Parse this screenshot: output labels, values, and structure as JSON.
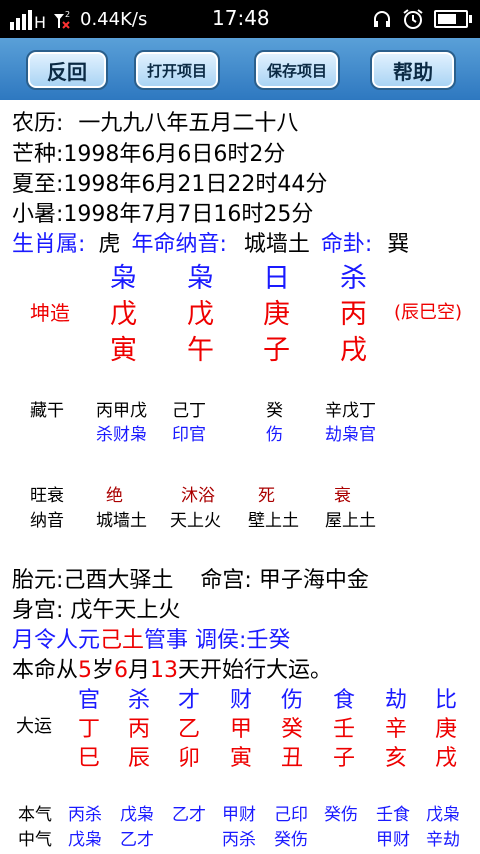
{
  "status": {
    "speed": "0.44K/s",
    "time": "17:48"
  },
  "toolbar": {
    "back": "反回",
    "open": "打开项目",
    "save": "保存项目",
    "help": "帮助"
  },
  "info": {
    "lunar_label": "农历:",
    "lunar": "一九九八年五月二十八",
    "line2": "芒种:1998年6月6日6时2分",
    "line3": "夏至:1998年6月21日22时44分",
    "line4": "小暑:1998年7月7日16时25分"
  },
  "zodiac": {
    "shengxiao_label": "生肖属:",
    "shengxiao": "虎",
    "nayin_label": "年命纳音:",
    "nayin": "城墙土",
    "minggua_label": "命卦:",
    "minggua": "巽"
  },
  "chart": {
    "gender": "坤造",
    "kongwang": "(辰巳空)",
    "gods": [
      "枭",
      "枭",
      "日",
      "杀"
    ],
    "stems": [
      "戊",
      "戊",
      "庚",
      "丙"
    ],
    "branches": [
      "寅",
      "午",
      "子",
      "戌"
    ]
  },
  "hidden": {
    "label": "藏干",
    "stems": [
      "丙甲戊",
      "己丁",
      "癸",
      "辛戊丁"
    ],
    "gods": [
      "杀财枭",
      "印官",
      "伤",
      "劫枭官"
    ]
  },
  "state": {
    "wang_label": "旺衰",
    "wang": [
      "绝",
      "沐浴",
      "死",
      "衰"
    ],
    "nayin_label": "纳音",
    "nayin": [
      "城墙土",
      "天上火",
      "壁上土",
      "屋上土"
    ]
  },
  "palace": {
    "taiyuan": "胎元:己酉大驿土",
    "minggong": "命宫: 甲子海中金",
    "shengong": "身宫: 戊午天上火"
  },
  "yueling": {
    "p1": "月令人元",
    "p2": "己土",
    "p3": "管事 调侯:壬癸"
  },
  "dayun_start": {
    "p1": "本命从",
    "n1": "5",
    "p2": "岁",
    "n2": "6",
    "p3": "月",
    "n3": "13",
    "p4": "天开始行大运。"
  },
  "dayun": {
    "label": "大运",
    "gods": [
      "官",
      "杀",
      "才",
      "财",
      "伤",
      "食",
      "劫",
      "比"
    ],
    "stems": [
      "丁",
      "丙",
      "乙",
      "甲",
      "癸",
      "壬",
      "辛",
      "庚"
    ],
    "branches": [
      "巳",
      "辰",
      "卯",
      "寅",
      "丑",
      "子",
      "亥",
      "戌"
    ],
    "benqi_label": "本气",
    "benqi": [
      "丙杀",
      "戊枭",
      "乙才",
      "甲财",
      "己印",
      "癸伤",
      "壬食",
      "戊枭"
    ],
    "zhongqi_label": "中气",
    "zhongqi": [
      "戊枭",
      "乙才",
      "",
      "丙杀",
      "癸伤",
      "",
      "甲财",
      "辛劫"
    ]
  }
}
